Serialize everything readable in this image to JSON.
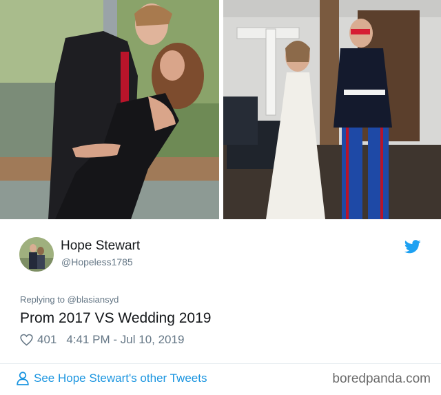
{
  "colors": {
    "accent": "#1da1f2",
    "link": "#1b95e0",
    "muted": "#657786",
    "text": "#14171a"
  },
  "photos": {
    "left_alt": "Couple posing at prom on a bridge",
    "right_alt": "Couple holding hands in wedding dress and dress blues"
  },
  "tweet": {
    "author_name": "Hope Stewart",
    "author_handle": "@Hopeless1785",
    "reply_prefix": "Replying to",
    "reply_handle": "@blasiansyd",
    "text": "Prom 2017 VS Wedding 2019",
    "like_count": "401",
    "timestamp": "4:41 PM - Jul 10, 2019",
    "icons": {
      "platform": "twitter-bird-icon",
      "like": "heart-icon",
      "profile": "person-icon"
    }
  },
  "footer": {
    "other_tweets_label": "See Hope Stewart's other Tweets",
    "watermark": "boredpanda.com"
  }
}
